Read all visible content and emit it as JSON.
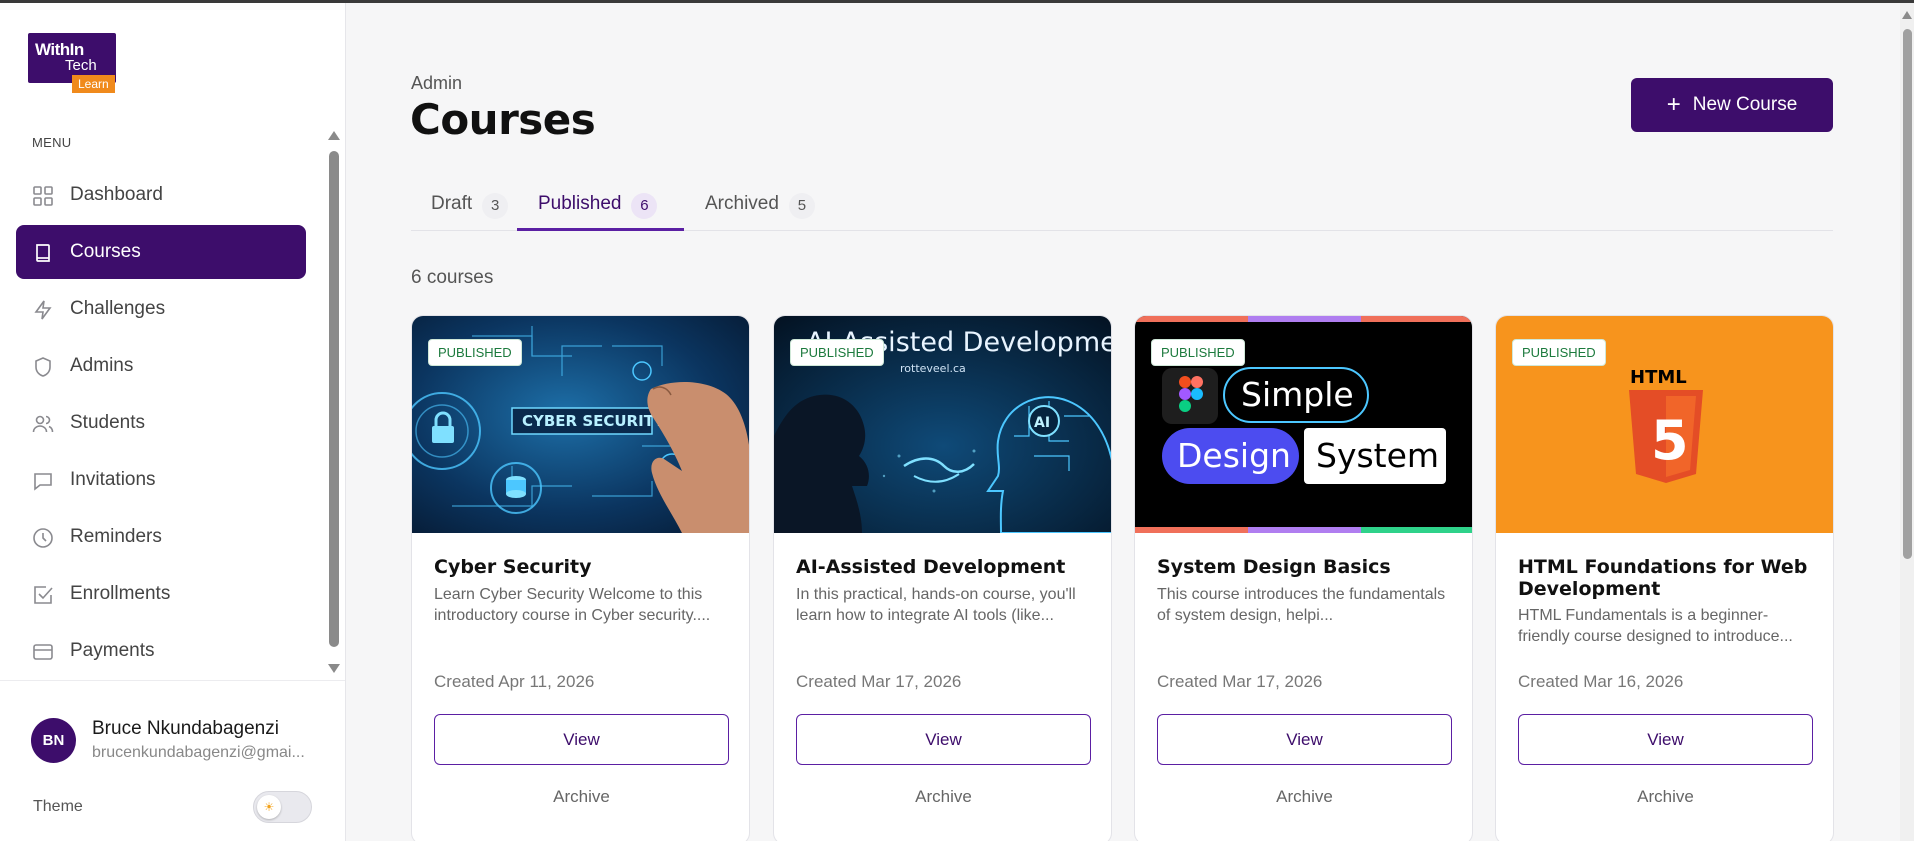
{
  "brand": {
    "line1": "WithIn",
    "line2": "Tech",
    "badge": "Learn"
  },
  "sidebar": {
    "menu_title": "MENU",
    "items": [
      {
        "label": "Dashboard",
        "icon": "grid-icon",
        "active": false
      },
      {
        "label": "Courses",
        "icon": "book-icon",
        "active": true
      },
      {
        "label": "Challenges",
        "icon": "bolt-icon",
        "active": false
      },
      {
        "label": "Admins",
        "icon": "shield-icon",
        "active": false
      },
      {
        "label": "Students",
        "icon": "users-icon",
        "active": false
      },
      {
        "label": "Invitations",
        "icon": "chat-icon",
        "active": false
      },
      {
        "label": "Reminders",
        "icon": "clock-icon",
        "active": false
      },
      {
        "label": "Enrollments",
        "icon": "checkbox-icon",
        "active": false
      },
      {
        "label": "Payments",
        "icon": "card-icon",
        "active": false
      }
    ]
  },
  "user": {
    "initials": "BN",
    "name": "Bruce Nkundabagenzi",
    "email": "brucenkundabagenzi@gmai..."
  },
  "theme": {
    "label": "Theme",
    "icon": "sun-icon"
  },
  "header": {
    "breadcrumb": "Admin",
    "title": "Courses",
    "new_button": "New Course"
  },
  "tabs": [
    {
      "label": "Draft",
      "count": "3",
      "active": false
    },
    {
      "label": "Published",
      "count": "6",
      "active": true
    },
    {
      "label": "Archived",
      "count": "5",
      "active": false
    }
  ],
  "course_count": "6 courses",
  "cards": [
    {
      "badge": "PUBLISHED",
      "title": "Cyber Security",
      "description": "Learn Cyber Security Welcome to this introductory course in Cyber security....",
      "created": "Created Apr 11, 2026",
      "thumb_text": "CYBER SECURITY",
      "view": "View",
      "archive": "Archive"
    },
    {
      "badge": "PUBLISHED",
      "title": "AI-Assisted Development",
      "description": "In this practical, hands-on course, you'll learn how to integrate AI tools (like...",
      "created": "Created Mar 17, 2026",
      "thumb_text": "AI-Assisted Development",
      "thumb_sub": "rotteveel.ca",
      "thumb_ai": "AI",
      "view": "View",
      "archive": "Archive"
    },
    {
      "badge": "PUBLISHED",
      "title": "System Design Basics",
      "description": "This course introduces the fundamentals of system design, helpi...",
      "created": "Created Mar 17, 2026",
      "thumb_words": [
        "Simple",
        "Design",
        "System"
      ],
      "view": "View",
      "archive": "Archive"
    },
    {
      "badge": "PUBLISHED",
      "title": "HTML Foundations for Web Development",
      "description": "HTML Fundamentals is a beginner-friendly course designed to introduce...",
      "created": "Created Mar 16, 2026",
      "thumb_text": "HTML",
      "thumb_num": "5",
      "view": "View",
      "archive": "Archive"
    }
  ],
  "colors": {
    "brand_purple": "#3d0d6b",
    "brand_orange": "#f08a1c",
    "badge_green": "#1c7a3d",
    "html_orange": "#f7941d"
  }
}
